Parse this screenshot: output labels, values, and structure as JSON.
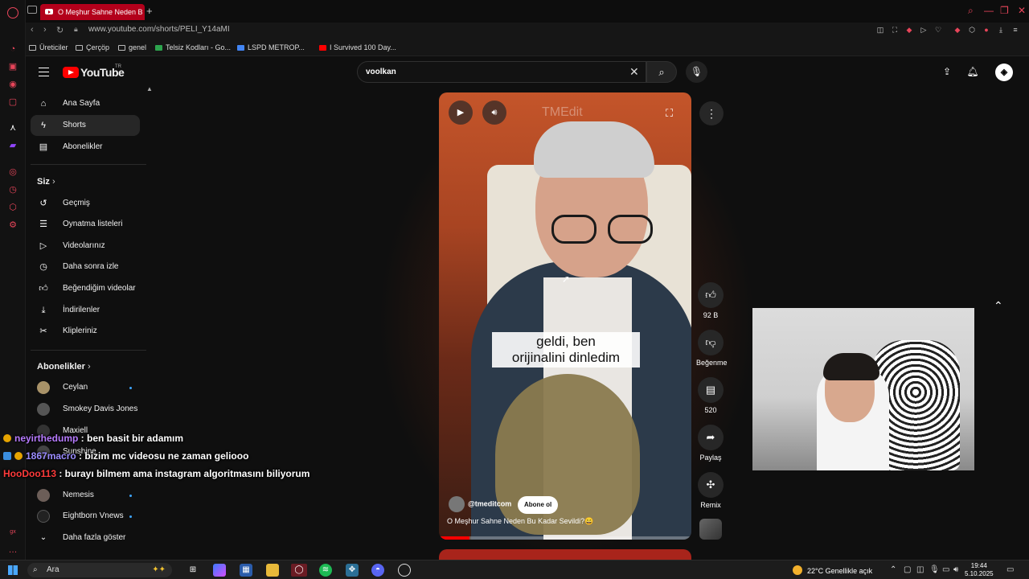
{
  "browser": {
    "tab_title": "O Meşhur Sahne Neden B",
    "url": "www.youtube.com/shorts/PELI_Y14aMI",
    "bookmarks": [
      "Üreticiler",
      "Çerçöp",
      "genel",
      "Telsiz Kodları - Go...",
      "LSPD METROP...",
      "I Survived 100 Day..."
    ]
  },
  "youtube": {
    "logo_text": "YouTube",
    "country_code": "TR",
    "search_value": "voolkan",
    "sidebar": {
      "main": [
        "Ana Sayfa",
        "Shorts",
        "Abonelikler"
      ],
      "you_header": "Siz",
      "you_items": [
        "Geçmiş",
        "Oynatma listeleri",
        "Videolarınız",
        "Daha sonra izle",
        "Beğendiğim videolar",
        "İndirilenler",
        "Klipleriniz"
      ],
      "subs_header": "Abonelikler",
      "subs": [
        "Ceylan",
        "Smokey Davis Jones",
        "Maxiell",
        "Sunshine",
        "Nemesis",
        "Eightborn Vnews"
      ],
      "show_more": "Daha fazla göster"
    },
    "video": {
      "watermark": "TMEdit",
      "caption_line1": "geldi, ben",
      "caption_line2": "orijinalini dinledim",
      "channel": "@tmeditcom",
      "subscribe_label": "Abone ol",
      "title": "O Meşhur Sahne Neden Bu Kadar Sevildi?😄",
      "progress": 0.12
    },
    "actions": {
      "likes": "92 B",
      "dislike_label": "Beğenme",
      "comments": "520",
      "share_label": "Paylaş",
      "remix_label": "Remix"
    }
  },
  "chat": [
    {
      "user": "neyirthedump",
      "message": " : ben basit bir adamım",
      "color": "#b77bff"
    },
    {
      "user": "1867macro",
      "message": " : bizim mc videosu ne zaman geliooo",
      "color": "#9b8cff"
    },
    {
      "user": "HooDoo113",
      "message": " : burayı bilmem ama instagram algoritmasını biliyorum",
      "color": "#ff3b3b"
    }
  ],
  "taskbar": {
    "search_placeholder": "Ara",
    "weather": "22°C  Genellikle açık",
    "time": "19:44",
    "date": "5.10.2025"
  }
}
